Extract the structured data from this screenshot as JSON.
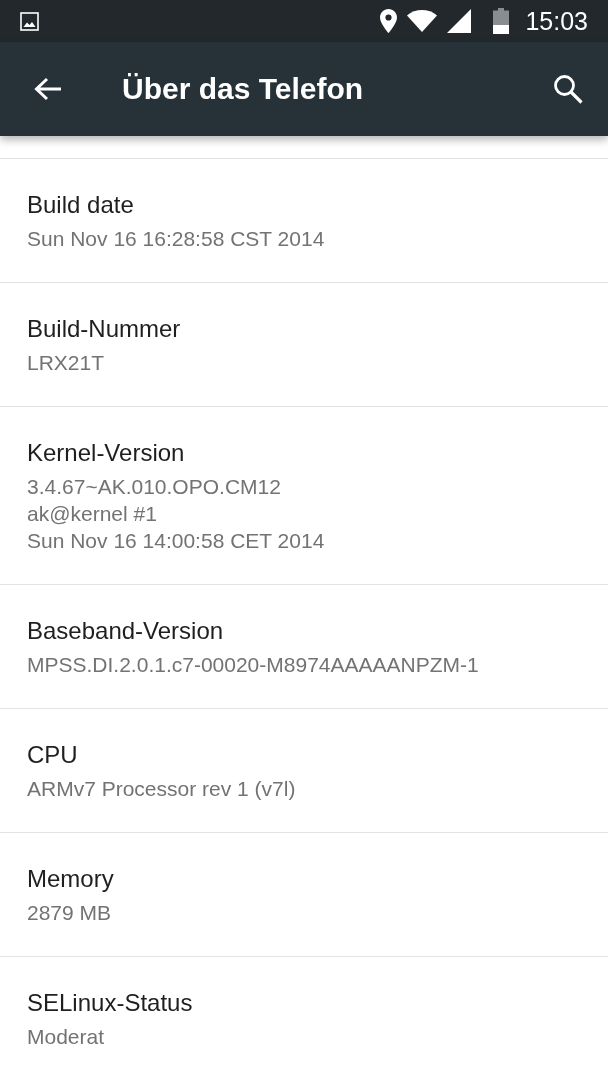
{
  "status_bar": {
    "time": "15:03"
  },
  "app_bar": {
    "title": "Über das Telefon"
  },
  "items": [
    {
      "title": "Build date",
      "summary": [
        "Sun Nov 16 16:28:58 CST 2014"
      ]
    },
    {
      "title": "Build-Nummer",
      "summary": [
        "LRX21T"
      ]
    },
    {
      "title": "Kernel-Version",
      "summary": [
        "3.4.67~AK.010.OPO.CM12",
        "ak@kernel #1",
        "Sun Nov 16 14:00:58 CET 2014"
      ]
    },
    {
      "title": "Baseband-Version",
      "summary": [
        "MPSS.DI.2.0.1.c7-00020-M8974AAAAANPZM-1"
      ]
    },
    {
      "title": "CPU",
      "summary": [
        "ARMv7 Processor rev 1 (v7l)"
      ]
    },
    {
      "title": "Memory",
      "summary": [
        "2879 MB"
      ]
    },
    {
      "title": "SELinux-Status",
      "summary": [
        "Moderat"
      ]
    }
  ]
}
